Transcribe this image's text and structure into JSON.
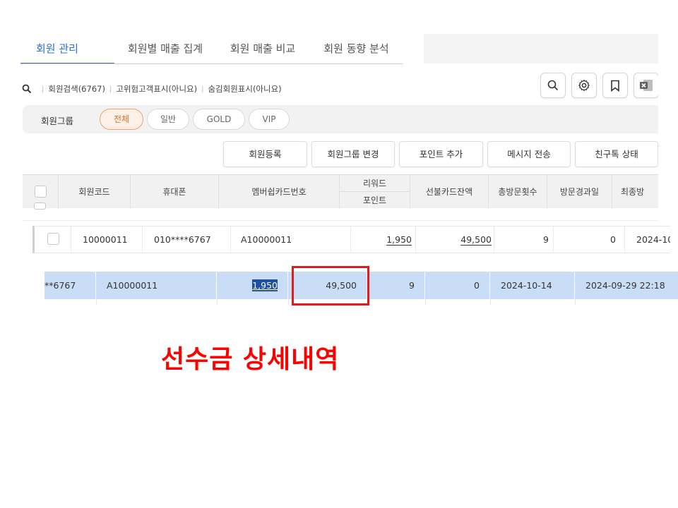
{
  "tabs": [
    "회원 관리",
    "회원별 매출 집계",
    "회원 매출 비교",
    "회원 동향 분석"
  ],
  "search": {
    "items": [
      "회원검색(6767)",
      "고위험고객표시(아니요)",
      "숨김회원표시(아니요)"
    ]
  },
  "toolbar_icons": [
    "search-icon",
    "settings-icon",
    "bookmark-icon",
    "excel-icon"
  ],
  "group_filter": {
    "label": "회원그룹",
    "options": [
      "전체",
      "일반",
      "GOLD",
      "VIP"
    ],
    "selected": "전체"
  },
  "actions": [
    "회원등록",
    "회원그룹 변경",
    "포인트 추가",
    "메시지 전송",
    "친구톡 상태"
  ],
  "table": {
    "headers": {
      "member_code": "회원코드",
      "phone": "휴대폰",
      "card_no": "멤버쉽카드번호",
      "reward_top": "리워드",
      "reward_bottom": "포인트",
      "prepaid": "선불카드잔액",
      "visits": "총방문횟수",
      "days_since": "방문경과일",
      "last_visit": "최종방"
    },
    "row": {
      "member_code": "10000011",
      "phone": "010****6767",
      "card_no": "A10000011",
      "reward": "1,950",
      "prepaid": "49,500",
      "visits": "9",
      "days_since": "0",
      "last_date_partial": "2024-10"
    },
    "selected_row": {
      "phone_partial": "**6767",
      "card_no": "A10000011",
      "reward": "1,950",
      "prepaid": "49,500",
      "visits": "9",
      "days_since": "0",
      "last_visit": "2024-10-14",
      "registered": "2024-09-29 22:18"
    }
  },
  "caption": "선수금 상세내역",
  "colors": {
    "accent": "#2f6fd6",
    "highlight_red": "#e01b1b",
    "selection": "#c9ddf7"
  }
}
